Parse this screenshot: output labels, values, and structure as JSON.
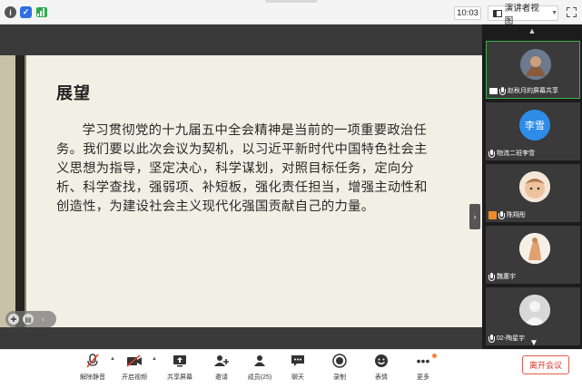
{
  "topbar": {
    "time": "10:03",
    "view_label": "演讲者视图",
    "icons": [
      "info-icon",
      "shield-icon",
      "signal-icon",
      "fullscreen-icon"
    ]
  },
  "slide": {
    "title": "展望",
    "body": "学习贯彻党的十九届五中全会精神是当前的一项重要政治任务。我们要以此次会议为契机，以习近平新时代中国特色社会主义思想为指导，坚定决心，科学谋划，对照目标任务，定向分析、科学查找，强弱项、补短板，强化责任担当，增强主动性和创造性，为建设社会主义现代化强国贡献自己的力量。"
  },
  "participants": [
    {
      "name": "赵秋月的屏幕共享",
      "avatar_text": "",
      "avatar_color": "#5a6a80",
      "sharing": true,
      "active": true
    },
    {
      "name": "物流二班李雪",
      "avatar_text": "李雪",
      "avatar_color": "#2e8be8",
      "sharing": false,
      "active": false
    },
    {
      "name": "陈翔彤",
      "avatar_text": "",
      "avatar_color": "#d9b08c",
      "sharing": false,
      "active": false,
      "host": true
    },
    {
      "name": "魏惠宇",
      "avatar_text": "",
      "avatar_color": "#e2a77a",
      "sharing": false,
      "active": false
    },
    {
      "name": "02-陶星宇",
      "avatar_text": "",
      "avatar_color": "#d8d8d8",
      "sharing": false,
      "active": false
    }
  ],
  "toolbar": {
    "items": [
      {
        "label": "解除静音",
        "icon": "mic-muted-icon"
      },
      {
        "label": "开启视频",
        "icon": "video-off-icon"
      },
      {
        "label": "共享屏幕",
        "icon": "share-screen-icon"
      },
      {
        "label": "邀请",
        "icon": "invite-icon"
      },
      {
        "label": "成员(25)",
        "icon": "members-icon"
      },
      {
        "label": "聊天",
        "icon": "chat-icon"
      },
      {
        "label": "录制",
        "icon": "record-icon"
      },
      {
        "label": "表情",
        "icon": "emoji-icon"
      },
      {
        "label": "更多",
        "icon": "more-icon"
      }
    ],
    "leave_label": "离开会议"
  },
  "colors": {
    "accent_green": "#3bb34a",
    "leave_red": "#d9362b",
    "slide_bg": "#f2efe4"
  }
}
